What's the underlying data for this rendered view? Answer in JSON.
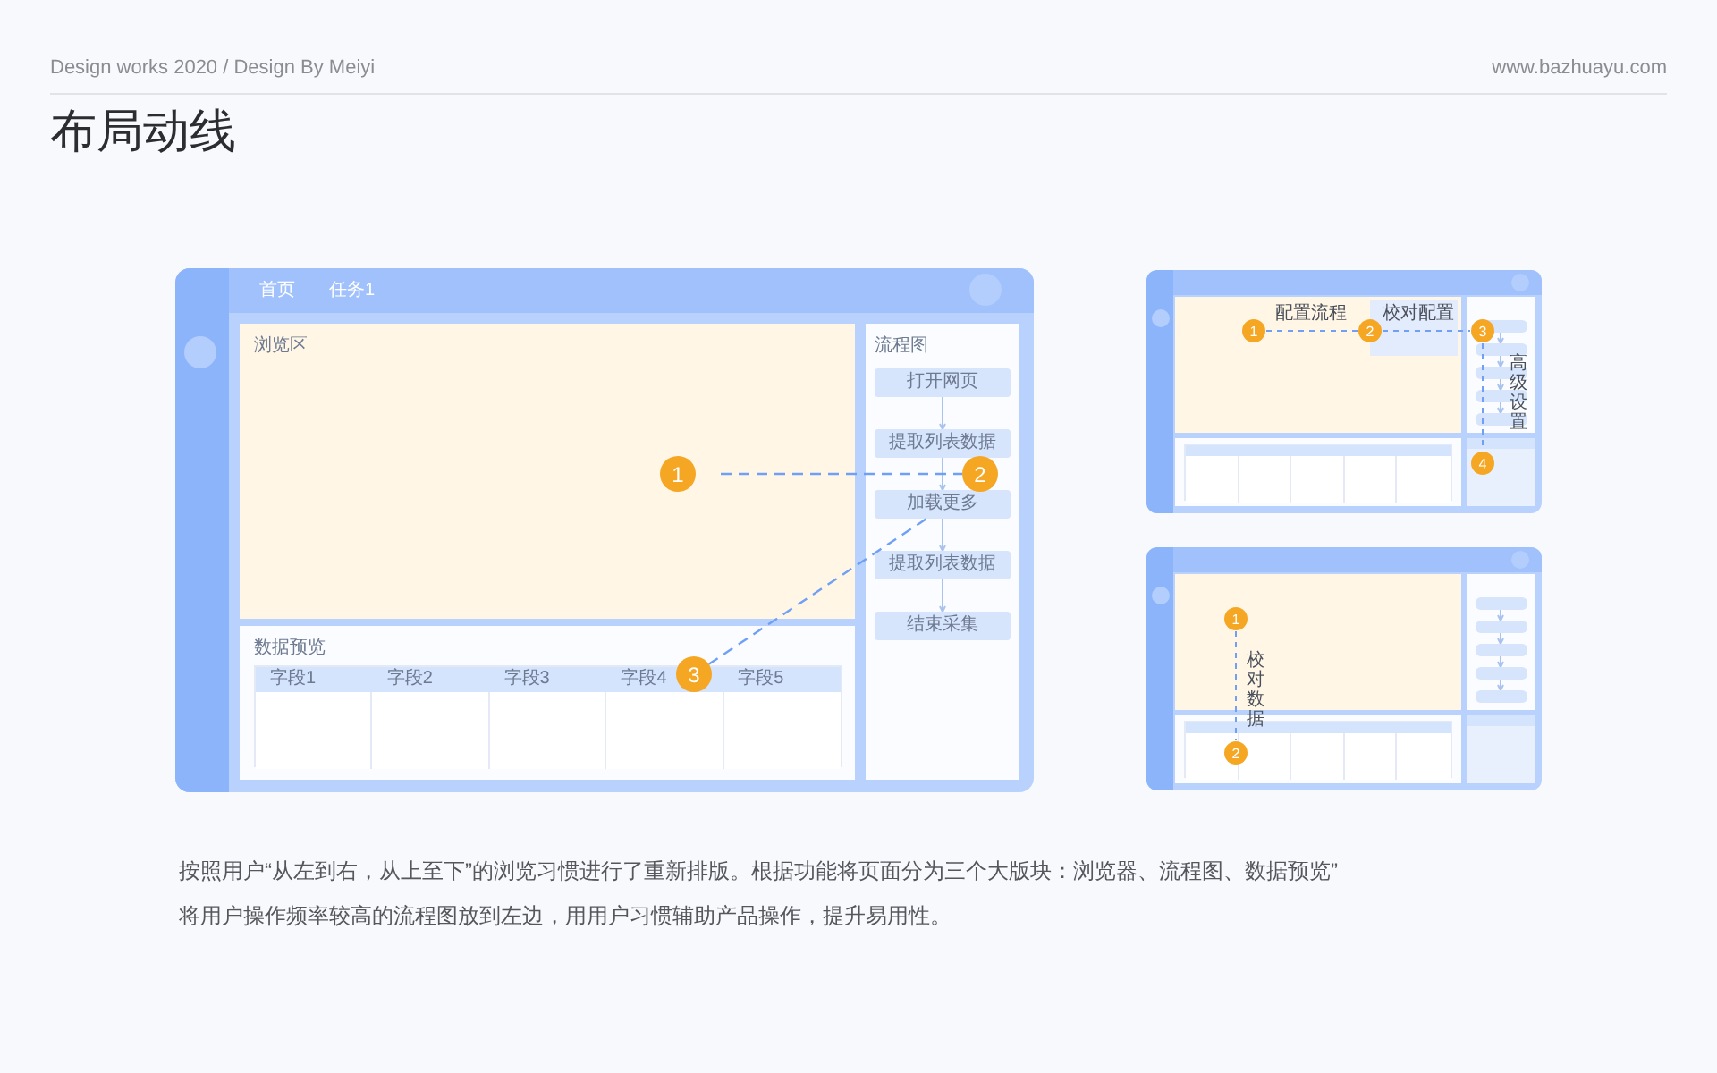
{
  "header": {
    "subtitle": "Design works 2020 / Design By Meiyi",
    "website": "www.bazhuayu.com",
    "title": "布局动线"
  },
  "main_mockup": {
    "nav": [
      "首页",
      "任务1"
    ],
    "browse_area": {
      "label": "浏览区"
    },
    "flow_panel": {
      "label": "流程图",
      "steps": [
        "打开网页",
        "提取列表数据",
        "加载更多",
        "提取列表数据",
        "结束采集"
      ]
    },
    "data_preview": {
      "label": "数据预览",
      "columns": [
        "字段1",
        "字段2",
        "字段3",
        "字段4",
        "字段5"
      ]
    },
    "markers": [
      "1",
      "2",
      "3"
    ]
  },
  "mockup_2": {
    "markers": [
      "1",
      "2",
      "3",
      "4"
    ],
    "labels": [
      {
        "kind": "plain",
        "text": "配置流程"
      },
      {
        "kind": "boxed",
        "text": "校对配置"
      },
      {
        "kind": "vertical",
        "text": "高级设置"
      }
    ]
  },
  "mockup_3": {
    "markers": [
      "1",
      "2"
    ],
    "labels": [
      {
        "kind": "vertical",
        "text": "校对数据"
      }
    ]
  },
  "description": [
    "按照用户“从左到右，从上至下”的浏览习惯进行了重新排版。根据功能将页面分为三个大版块：浏览器、流程图、数据预览”",
    "将用户操作频率较高的流程图放到左边，用用户习惯辅助产品操作，提升易用性。"
  ]
}
